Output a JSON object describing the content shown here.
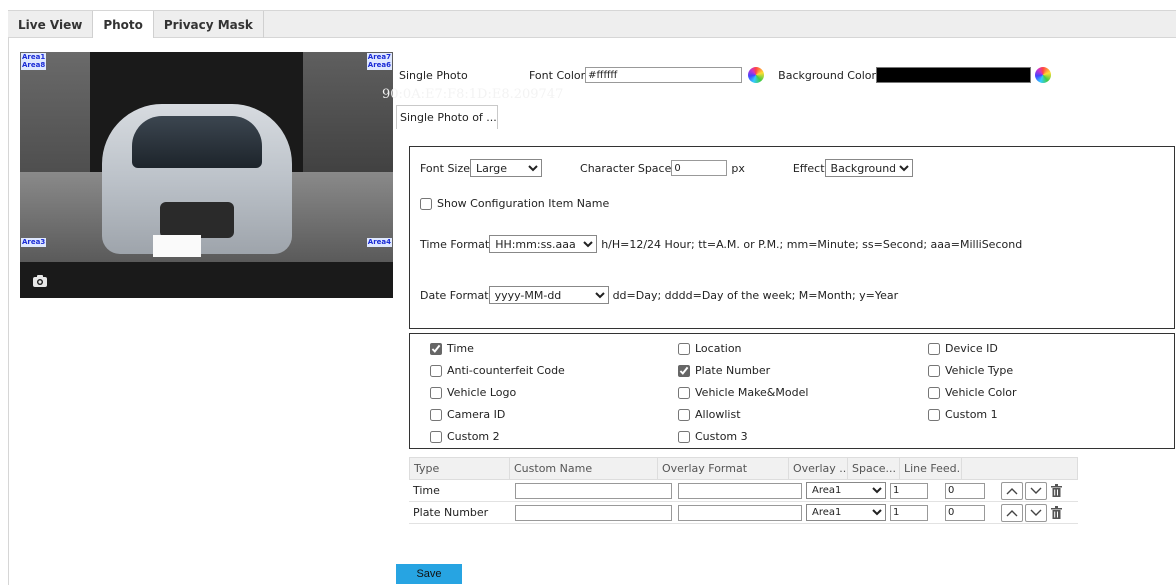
{
  "tabs": [
    {
      "label": "Live View",
      "active": false
    },
    {
      "label": "Photo",
      "active": true
    },
    {
      "label": "Privacy Mask",
      "active": false
    }
  ],
  "preview": {
    "area_labels": [
      "Area1",
      "Area8",
      "Area7",
      "Area6",
      "Area3",
      "Area4"
    ],
    "camera_icon": "camera-icon"
  },
  "top_settings": {
    "single_photo_label": "Single Photo",
    "font_color_label": "Font Color",
    "font_color_value": "#ffffff",
    "background_color_label": "Background Color",
    "background_color_value": "#000000",
    "color_picker_icon": "color-wheel-icon"
  },
  "subtab": {
    "label": "Single Photo of ..."
  },
  "format_panel": {
    "font_size_label": "Font Size",
    "font_size_value": "Large",
    "char_space_label": "Character Space",
    "char_space_value": "0",
    "char_space_unit": "px",
    "effect_label": "Effect",
    "effect_value": "Background",
    "show_config_label": "Show Configuration Item Name",
    "show_config_checked": false,
    "time_format_label": "Time Format",
    "time_format_value": "HH:mm:ss.aaa",
    "time_format_hint": "h/H=12/24 Hour; tt=A.M. or P.M.; mm=Minute; ss=Second; aaa=MilliSecond",
    "date_format_label": "Date Format",
    "date_format_value": "yyyy-MM-dd",
    "date_format_hint": "dd=Day; dddd=Day of the week; M=Month; y=Year"
  },
  "items_panel": {
    "items": [
      {
        "label": "Time",
        "checked": true
      },
      {
        "label": "Location",
        "checked": false
      },
      {
        "label": "Device ID",
        "checked": false
      },
      {
        "label": "Anti-counterfeit Code",
        "checked": false
      },
      {
        "label": "Plate Number",
        "checked": true
      },
      {
        "label": "Vehicle Type",
        "checked": false
      },
      {
        "label": "Vehicle Logo",
        "checked": false
      },
      {
        "label": "Vehicle Make&Model",
        "checked": false
      },
      {
        "label": "Vehicle Color",
        "checked": false
      },
      {
        "label": "Camera ID",
        "checked": false
      },
      {
        "label": "Allowlist",
        "checked": false
      },
      {
        "label": "Custom 1",
        "checked": false
      },
      {
        "label": "Custom 2",
        "checked": false
      },
      {
        "label": "Custom 3",
        "checked": false
      }
    ]
  },
  "table": {
    "headers": [
      "Type",
      "Custom Name",
      "Overlay Format",
      "Overlay ...",
      "Space...",
      "Line Feed..."
    ],
    "rows": [
      {
        "type": "Time",
        "custom_name": "",
        "overlay_format": "",
        "area": "Area1",
        "space": "1",
        "line_feed": "0"
      },
      {
        "type": "Plate Number",
        "custom_name": "",
        "overlay_format": "",
        "area": "Area1",
        "space": "1",
        "line_feed": "0"
      }
    ]
  },
  "save_label": "Save"
}
